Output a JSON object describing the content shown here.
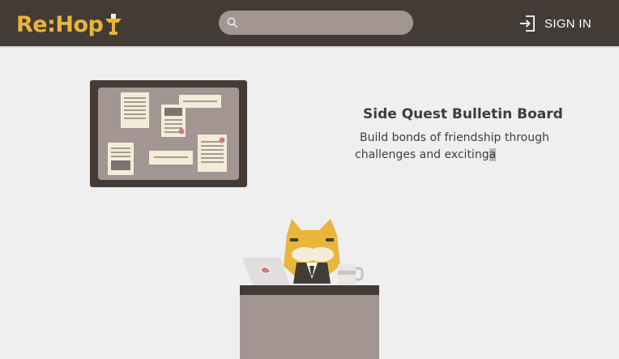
{
  "header": {
    "logo": {
      "part1": "Re:",
      "part2": "Hop",
      "icon": "lamp-icon"
    },
    "search": {
      "placeholder": "",
      "value": "",
      "icon": "search-icon"
    },
    "signin": {
      "label": "SIGN IN",
      "icon": "sign-in-icon"
    }
  },
  "main": {
    "title": "Side Quest Bulletin Board",
    "description_line1": "Build bonds of friendship through",
    "description_line2": "challenges and exciting",
    "description_tail": "a"
  },
  "colors": {
    "header_bg": "#433c36",
    "accent": "#e9b53b",
    "search_bg": "#a39592",
    "page_bg": "#efefef"
  }
}
